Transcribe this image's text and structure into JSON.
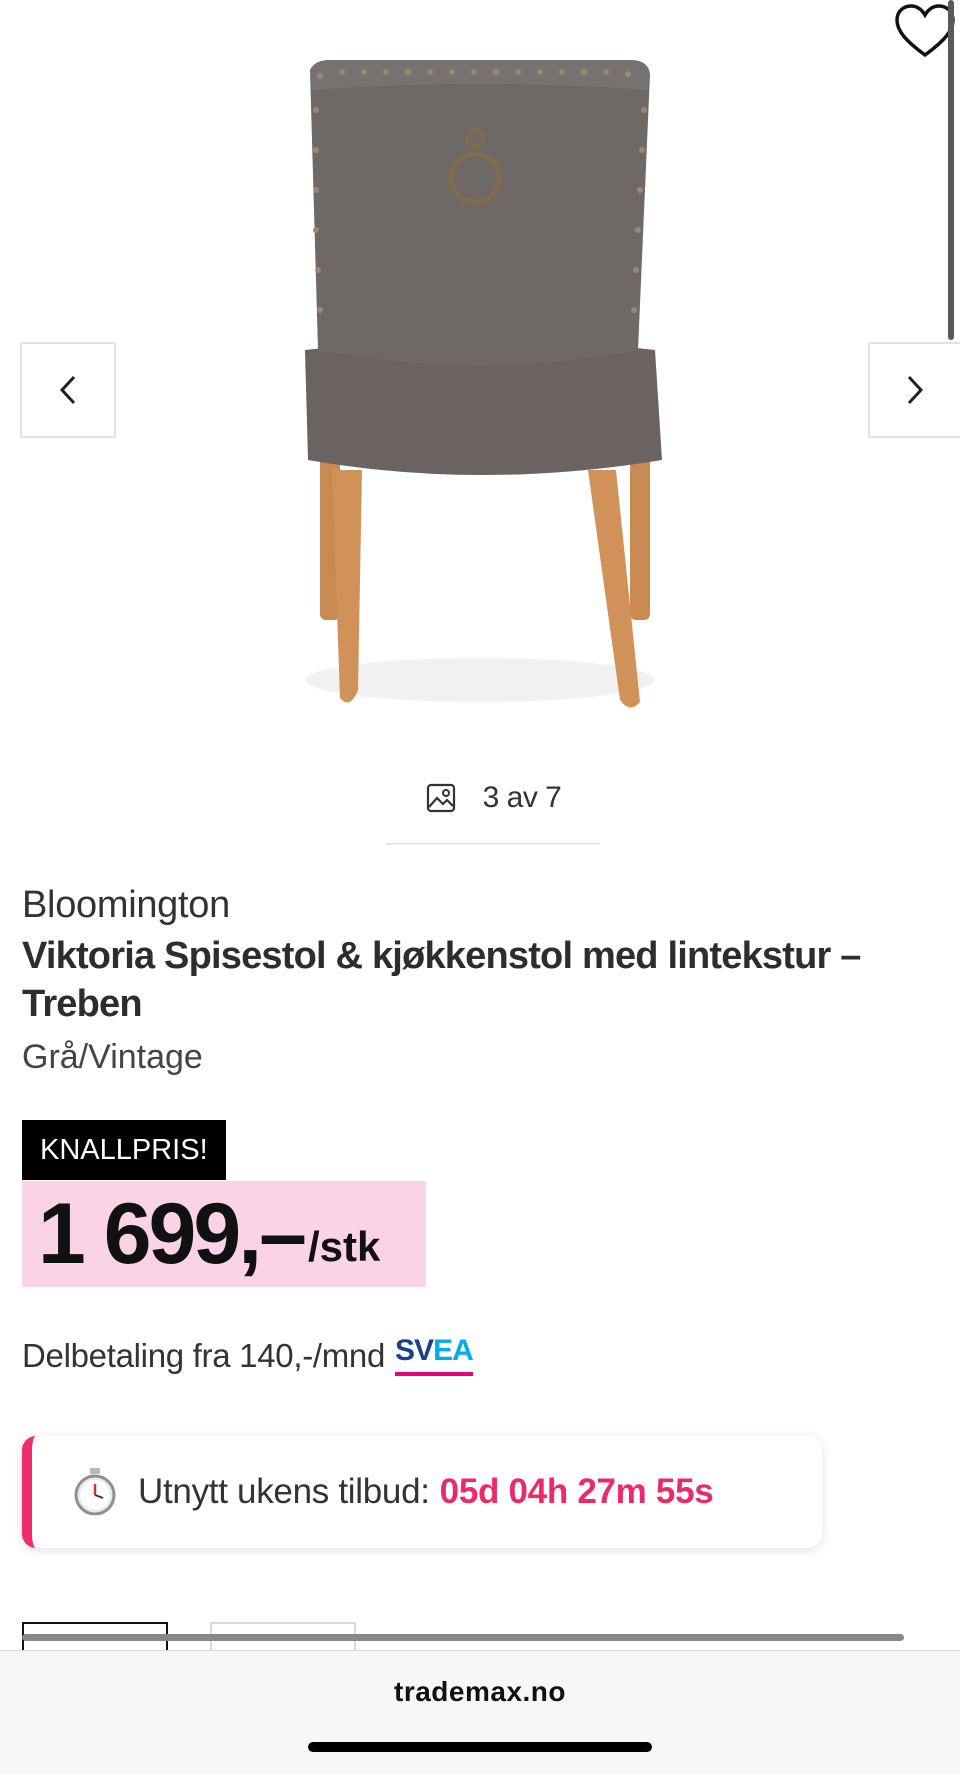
{
  "gallery": {
    "image_alt": "Viktoria Spisestol, grey upholstered back with ring handle and wooden legs",
    "counter": "3 av 7"
  },
  "product": {
    "brand": "Bloomington",
    "title": "Viktoria Spisestol & kjøkkenstol med lintekstur – Treben",
    "variant": "Grå/Vintage"
  },
  "pricing": {
    "badge": "KNALLPRIS!",
    "amount": "1 699,–",
    "unit": "/stk",
    "installment_text": "Delbetaling fra 140,-/mnd",
    "installment_provider_a": "SV",
    "installment_provider_b": "EA"
  },
  "countdown": {
    "label": "Utnytt ukens tilbud:",
    "value": "05d 04h 27m 55s"
  },
  "browser": {
    "url": "trademax.no"
  },
  "colors": {
    "price_bg": "#fbd3e6",
    "accent": "#ea2b69",
    "badge_bg": "#000000"
  },
  "icons": [
    "chevron-left-icon",
    "chevron-right-icon",
    "heart-icon",
    "image-icon",
    "stopwatch-icon"
  ]
}
